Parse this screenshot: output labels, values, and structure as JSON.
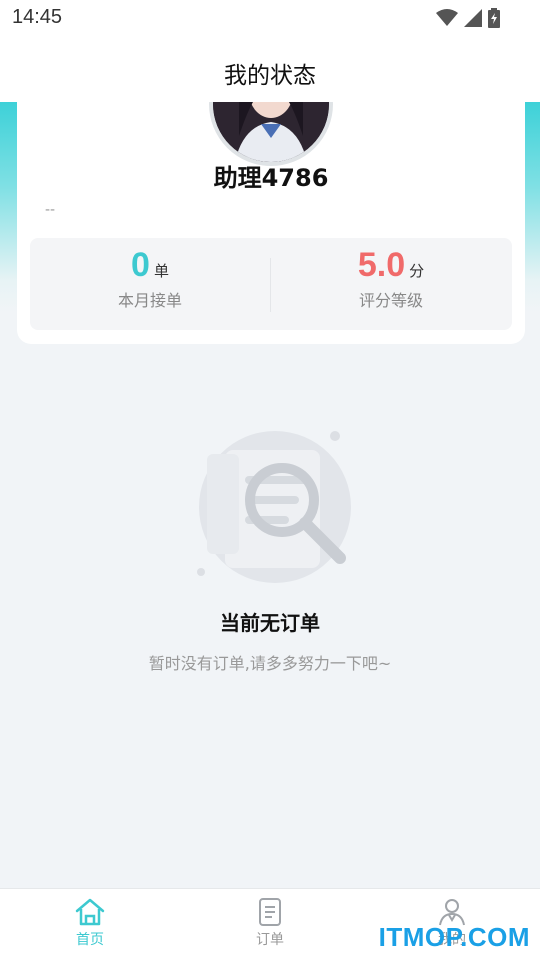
{
  "status_bar": {
    "time": "14:45"
  },
  "header": {
    "title": "我的状态"
  },
  "profile": {
    "name": "助理4786",
    "subtitle": "--"
  },
  "stats": {
    "orders": {
      "value": "0",
      "unit": "单",
      "label": "本月接单",
      "color": "#3dc9d0"
    },
    "rating": {
      "value": "5.0",
      "unit": "分",
      "label": "评分等级",
      "color": "#f06a6a"
    }
  },
  "empty_state": {
    "title": "当前无订单",
    "subtitle": "暂时没有订单,请多多努力一下吧~",
    "icon": "search-document-icon"
  },
  "tabbar": {
    "items": [
      {
        "label": "首页",
        "icon": "home-icon",
        "active": true
      },
      {
        "label": "订单",
        "icon": "orders-document-icon",
        "active": false
      },
      {
        "label": "我的",
        "icon": "profile-icon",
        "active": false
      }
    ]
  },
  "watermark": "ITMOP.COM",
  "accent_color": "#3dc9d0"
}
